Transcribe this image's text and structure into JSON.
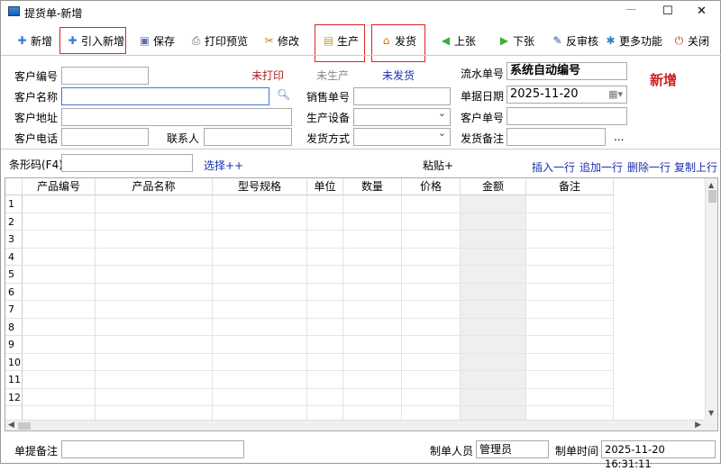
{
  "window": {
    "title": "提货单-新增",
    "minimize": "—",
    "maximize": "☐",
    "close": "✕"
  },
  "toolbar": [
    {
      "id": "new",
      "label": "新增",
      "icon": "plus-icon",
      "glyph": "✚",
      "color": "#3a7bd5"
    },
    {
      "id": "import-new",
      "label": "引入新增",
      "icon": "plus-icon",
      "glyph": "✚",
      "color": "#3a7bd5"
    },
    {
      "id": "save",
      "label": "保存",
      "icon": "floppy-disk-icon",
      "glyph": "▣",
      "color": "#5a6fb0"
    },
    {
      "id": "print-preview",
      "label": "打印预览",
      "icon": "printer-icon",
      "glyph": "⎙",
      "color": "#666"
    },
    {
      "id": "edit",
      "label": "修改",
      "icon": "tools-icon",
      "glyph": "✂",
      "color": "#b8860b"
    },
    {
      "id": "produce",
      "label": "生产",
      "icon": "briefcase-icon",
      "glyph": "▤",
      "color": "#c9a030"
    },
    {
      "id": "ship",
      "label": "发货",
      "icon": "home-icon",
      "glyph": "⌂",
      "color": "#d07010"
    },
    {
      "id": "prev",
      "label": "上张",
      "icon": "arrow-left-circle-icon",
      "glyph": "◀",
      "color": "#3cae3c"
    },
    {
      "id": "next",
      "label": "下张",
      "icon": "arrow-right-circle-icon",
      "glyph": "▶",
      "color": "#3cae3c"
    },
    {
      "id": "unaudit",
      "label": "反审核",
      "icon": "edit-document-icon",
      "glyph": "✎",
      "color": "#2c4fa0"
    },
    {
      "id": "more",
      "label": "更多功能",
      "icon": "gear-icon",
      "glyph": "✱",
      "color": "#2a7fd4"
    },
    {
      "id": "close",
      "label": "关闭",
      "icon": "power-icon",
      "glyph": "⏻",
      "color": "#d04020"
    }
  ],
  "status": {
    "print": "未打印",
    "production": "未生产",
    "shipping": "未发货",
    "mode": "新增"
  },
  "form": {
    "customer_no": {
      "label": "客户编号",
      "value": ""
    },
    "customer_name": {
      "label": "客户名称",
      "value": ""
    },
    "customer_address": {
      "label": "客户地址",
      "value": ""
    },
    "customer_phone": {
      "label": "客户电话",
      "value": ""
    },
    "contact": {
      "label": "联系人",
      "value": ""
    },
    "sales_no": {
      "label": "销售单号",
      "value": ""
    },
    "equipment": {
      "label": "生产设备",
      "value": ""
    },
    "ship_method": {
      "label": "发货方式",
      "value": ""
    },
    "serial_no": {
      "label": "流水单号",
      "value": "系统自动编号"
    },
    "doc_date": {
      "label": "单据日期",
      "value": "2025-11-20"
    },
    "customer_order": {
      "label": "客户单号",
      "value": ""
    },
    "ship_note": {
      "label": "发货备注",
      "value": "",
      "more": "..."
    }
  },
  "barcode": {
    "label": "条形码(F4)",
    "value": "",
    "select": "选择++",
    "paste": "粘贴+"
  },
  "row_actions": [
    "插入一行",
    "追加一行",
    "删除一行",
    "复制上行"
  ],
  "grid": {
    "columns": [
      "产品编号",
      "产品名称",
      "型号规格",
      "单位",
      "数量",
      "价格",
      "金额",
      "备注"
    ],
    "row_numbers": [
      "1",
      "2",
      "3",
      "4",
      "5",
      "6",
      "7",
      "8",
      "9",
      "10",
      "11",
      "12"
    ]
  },
  "footer": {
    "note_label": "单提备注",
    "note": "",
    "creator_label": "制单人员",
    "creator": "管理员",
    "time_label": "制单时间",
    "time": "2025-11-20 16:31:11"
  }
}
